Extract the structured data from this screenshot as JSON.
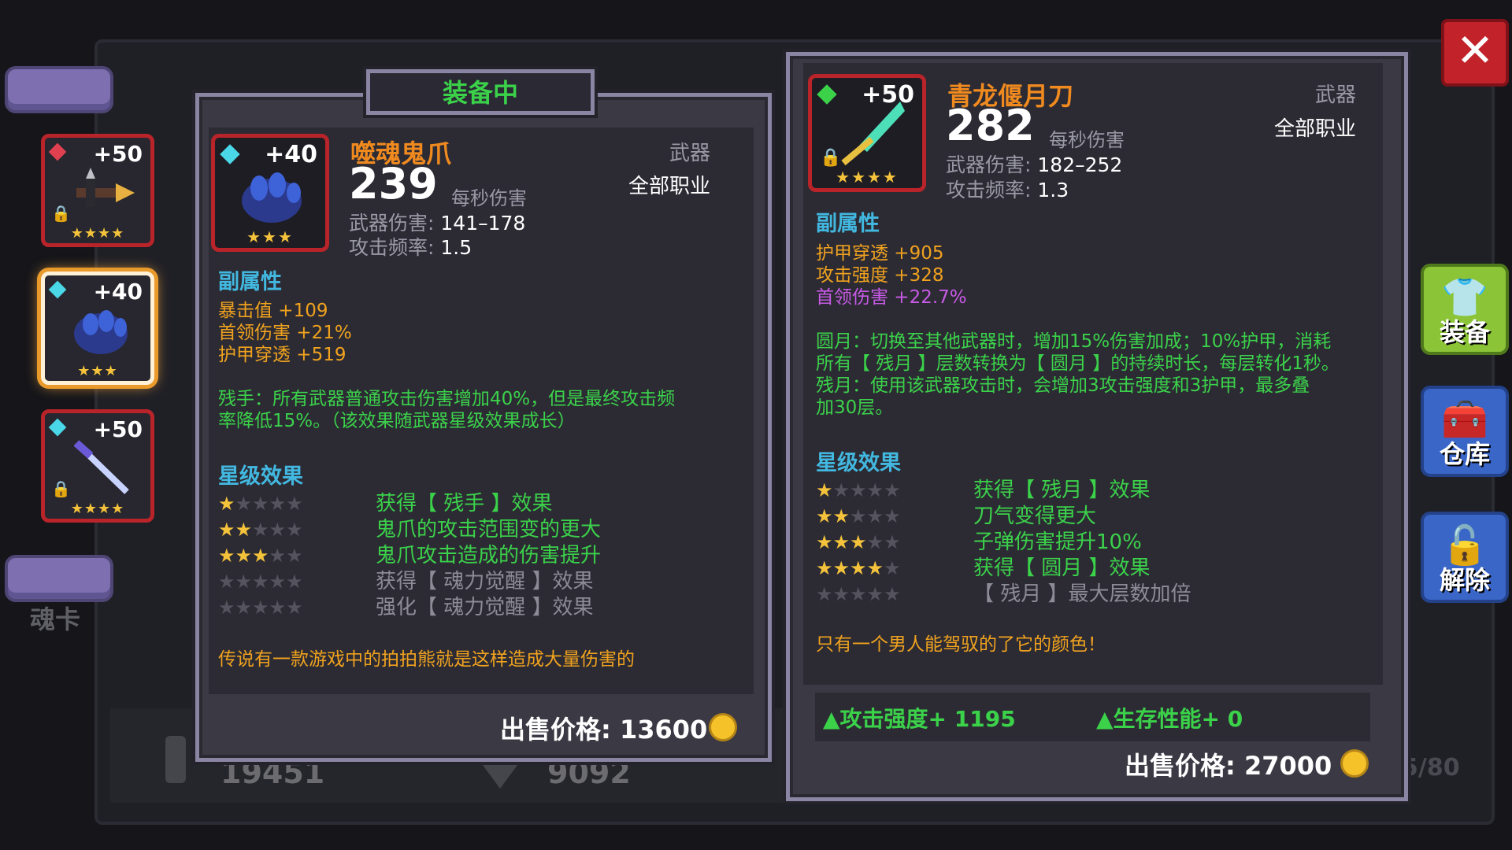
{
  "background": {
    "stat_left": "19451",
    "stat_right": "9092",
    "page_count": "5/80"
  },
  "left_slots": {
    "soul_card_label": "魂卡",
    "slots": [
      {
        "level": "+50",
        "gem_color": "#e04050",
        "stars": "★★★★",
        "icon": "crossbow-weapon-icon"
      },
      {
        "level": "+40",
        "gem_color": "#4ad8e8",
        "stars": "★★★",
        "icon": "ghost-claw-icon"
      },
      {
        "level": "+50",
        "gem_color": "#4ad8e8",
        "stars": "★★★★",
        "icon": "sword-icon"
      }
    ]
  },
  "equipped": {
    "tag": "装备中",
    "level": "+40",
    "stars": "★★★",
    "name": "噬魂鬼爪",
    "category": "武器",
    "class": "全部职业",
    "dps": "239",
    "dps_label": "每秒伤害",
    "damage_label": "武器伤害:",
    "damage": "141–178",
    "rate_label": "攻击频率:",
    "rate": "1.5",
    "sub_title": "副属性",
    "subs": [
      "暴击值 +109",
      "首领伤害 +21%",
      "护甲穿透 +519"
    ],
    "passive_1": "残手：所有武器普通攻击伤害增加40%，但是最终攻击频",
    "passive_2": "率降低15%。（该效果随武器星级效果成长）",
    "star_title": "星级效果",
    "star_effects": [
      {
        "on": 1,
        "text": "获得【 残手 】效果"
      },
      {
        "on": 2,
        "text": "鬼爪的攻击范围变的更大"
      },
      {
        "on": 3,
        "text": "鬼爪攻击造成的伤害提升"
      },
      {
        "on": 4,
        "text": "获得【 魂力觉醒 】效果"
      },
      {
        "on": 5,
        "text": "强化【 魂力觉醒 】效果"
      }
    ],
    "flavor": "传说有一款游戏中的拍拍熊就是这样造成大量伤害的",
    "price_label": "出售价格: 13600"
  },
  "compare": {
    "level": "+50",
    "stars": "★★★★",
    "name": "青龙偃月刀",
    "category": "武器",
    "class": "全部职业",
    "dps": "282",
    "dps_label": "每秒伤害",
    "damage_label": "武器伤害:",
    "damage": "182–252",
    "rate_label": "攻击频率:",
    "rate": "1.3",
    "sub_title": "副属性",
    "sub_1": "护甲穿透 +905",
    "sub_2": "攻击强度 +328",
    "sub_3": "首领伤害 +22.7%",
    "desc": [
      "圆月：切换至其他武器时，增加15%伤害加成；10%护甲，消耗",
      "所有【 残月 】层数转换为【 圆月 】的持续时长，每层转化1秒。",
      "残月：使用该武器攻击时，会增加3攻击强度和3护甲，最多叠",
      "加30层。"
    ],
    "star_title": "星级效果",
    "star_effects": [
      {
        "on": 1,
        "text": "获得【 残月 】效果"
      },
      {
        "on": 2,
        "text": "刀气变得更大"
      },
      {
        "on": 3,
        "text": "子弹伤害提升10%"
      },
      {
        "on": 4,
        "text": "获得【 圆月 】效果"
      },
      {
        "on": 5,
        "text": "【 残月 】最大层数加倍"
      }
    ],
    "flavor": "只有一个男人能驾驭的了它的颜色！",
    "diff_attack": "攻击强度+ 1195",
    "diff_survive": "生存性能+ 0",
    "price_label": "出售价格: 27000"
  },
  "side_buttons": {
    "equip": "装备",
    "storage": "仓库",
    "unlock": "解除"
  },
  "colors": {
    "green": "#3bd24a",
    "orange": "#f0a21e",
    "blue": "#42b8e0",
    "purple": "#c85ae6",
    "red": "#b8242a"
  }
}
